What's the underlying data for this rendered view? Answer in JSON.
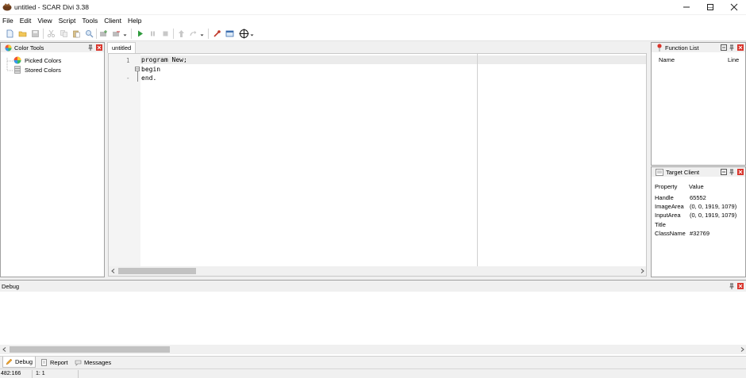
{
  "window": {
    "title": "untitled - SCAR Divi 3.38",
    "minimize_label": "—",
    "maximize_label": "☐",
    "close_label": "✕"
  },
  "menu": [
    "File",
    "Edit",
    "View",
    "Script",
    "Tools",
    "Client",
    "Help"
  ],
  "toolbar": {
    "icons": [
      "new-file-icon",
      "open-folder-icon",
      "save-icon",
      "cut-icon",
      "copy-icon",
      "paste-icon",
      "find-icon",
      "add-include-icon",
      "remove-include-icon",
      "run-icon",
      "pause-icon",
      "stop-icon",
      "compile-icon",
      "redo-icon",
      "color-picker-icon",
      "target-window-icon",
      "crosshair-icon"
    ]
  },
  "color_tools": {
    "title": "Color Tools",
    "items": [
      "Picked Colors",
      "Stored Colors"
    ]
  },
  "editor": {
    "tab_label": "untitled",
    "line_numbers": [
      "1",
      "-"
    ],
    "lines": [
      "program New;",
      "begin",
      "end."
    ]
  },
  "function_list": {
    "title": "Function List",
    "columns": [
      "Name",
      "Line"
    ]
  },
  "target_client": {
    "title": "Target Client",
    "columns": [
      "Property",
      "Value"
    ],
    "rows": [
      {
        "property": "Handle",
        "value": "65552"
      },
      {
        "property": "ImageArea",
        "value": "(0, 0, 1919, 1079)"
      },
      {
        "property": "InputArea",
        "value": "(0, 0, 1919, 1079)"
      },
      {
        "property": "Title",
        "value": ""
      },
      {
        "property": "ClassName",
        "value": "#32769"
      }
    ]
  },
  "debug": {
    "title": "Debug"
  },
  "bottom_tabs": [
    {
      "label": "Debug",
      "icon": "pencil-icon",
      "active": true
    },
    {
      "label": "Report",
      "icon": "report-icon",
      "active": false
    },
    {
      "label": "Messages",
      "icon": "messages-icon",
      "active": false
    }
  ],
  "status": {
    "mouse_pos": "482:166",
    "cursor_pos": "1: 1"
  },
  "colors": {
    "close_red": "#d9342b",
    "run_green": "#2e9a3c"
  }
}
